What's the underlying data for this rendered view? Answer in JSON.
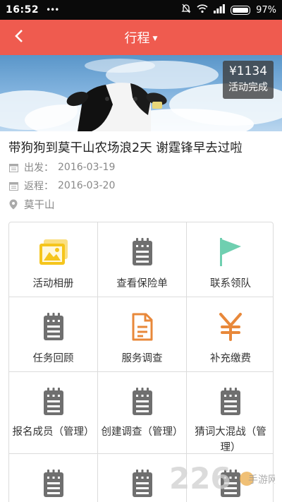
{
  "status_bar": {
    "time": "16:52",
    "battery": "97%"
  },
  "nav": {
    "title": "行程",
    "back_icon": "back-arrow-icon"
  },
  "banner": {
    "price": "¥1134",
    "status": "活动完成"
  },
  "event": {
    "title": "带狗狗到莫干山农场浪2天 谢霆锋早去过啦",
    "depart_label": "出发：",
    "depart_date": "2016-03-19",
    "return_label": "返程：",
    "return_date": "2016-03-20",
    "location": "莫干山"
  },
  "menu": {
    "items": [
      {
        "label": "活动相册",
        "icon": "photo-album-icon",
        "color": "#f5c51c"
      },
      {
        "label": "查看保险单",
        "icon": "notepad-icon",
        "color": "#6f6f6f"
      },
      {
        "label": "联系领队",
        "icon": "flag-icon",
        "color": "#6fcfb0"
      },
      {
        "label": "任务回顾",
        "icon": "notepad-icon",
        "color": "#6f6f6f"
      },
      {
        "label": "服务调查",
        "icon": "document-icon",
        "color": "#e8883a"
      },
      {
        "label": "补充缴费",
        "icon": "yen-icon",
        "color": "#e8883a"
      },
      {
        "label": "报名成员（管理）",
        "icon": "notepad-icon",
        "color": "#6f6f6f"
      },
      {
        "label": "创建调查（管理）",
        "icon": "notepad-icon",
        "color": "#6f6f6f"
      },
      {
        "label": "猜词大混战（管理）",
        "icon": "notepad-icon",
        "color": "#6f6f6f"
      },
      {
        "label": "",
        "icon": "notepad-icon",
        "color": "#6f6f6f"
      },
      {
        "label": "",
        "icon": "notepad-icon",
        "color": "#6f6f6f"
      },
      {
        "label": "",
        "icon": "notepad-icon",
        "color": "#6f6f6f"
      }
    ]
  },
  "watermark": {
    "number": "226",
    "text": "手游网"
  },
  "colors": {
    "nav": "#ef5b4f",
    "grid_border": "#dcdcdc",
    "muted": "#888888"
  }
}
